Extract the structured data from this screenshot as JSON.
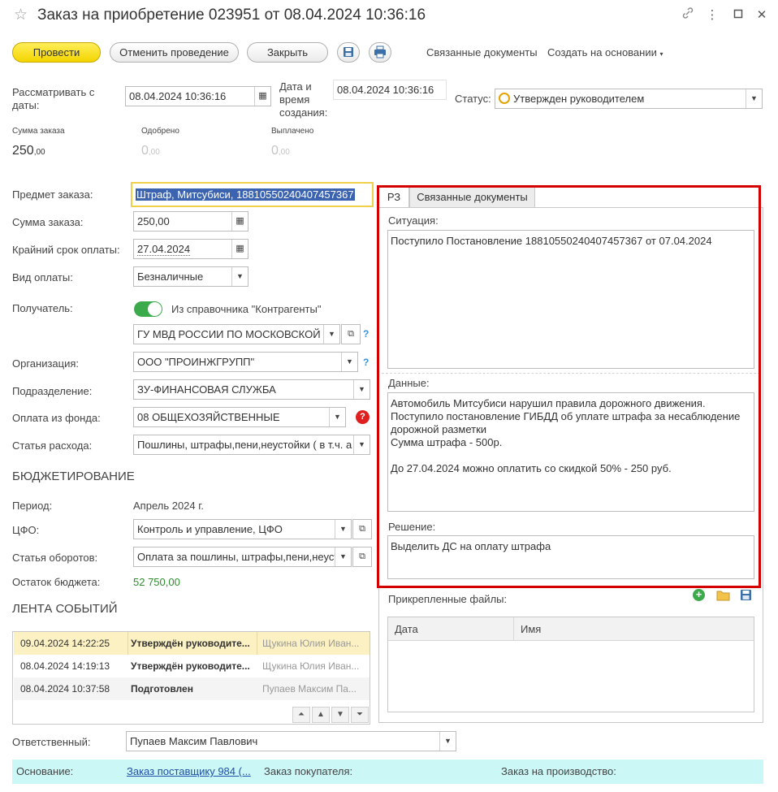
{
  "window": {
    "title": "Заказ на приобретение 023951 от 08.04.2024 10:36:16"
  },
  "toolbar": {
    "post": "Провести",
    "unpost": "Отменить проведение",
    "close": "Закрыть",
    "related_docs": "Связанные документы",
    "create_based": "Создать на основании"
  },
  "header": {
    "consider_from_label": "Рассматривать с даты:",
    "consider_from_value": "08.04.2024 10:36:16",
    "created_label": "Дата и время создания:",
    "created_value": "08.04.2024 10:36:16",
    "status_label": "Статус:",
    "status_value": "Утвержден руководителем"
  },
  "sums": {
    "order_label": "Сумма заказа",
    "order_int": "250",
    "order_dec": ",00",
    "approved_label": "Одобрено",
    "approved_int": "0",
    "approved_dec": ",00",
    "paid_label": "Выплачено",
    "paid_int": "0",
    "paid_dec": ",00"
  },
  "form": {
    "subject_label": "Предмет заказа:",
    "subject_value": "Штраф, Митсубиси, 18810550240407457367",
    "amount_label": "Сумма заказа:",
    "amount_value": "250,00",
    "due_label": "Крайний срок оплаты:",
    "due_value": "27.04.2024",
    "paytype_label": "Вид оплаты:",
    "paytype_value": "Безналичные",
    "recipient_label": "Получатель:",
    "recipient_toggle": "Из справочника \"Контрагенты\"",
    "recipient_value": "ГУ МВД РОССИИ ПО МОСКОВСКОЙ",
    "org_label": "Организация:",
    "org_value": "ООО \"ПРОИНЖГРУПП\"",
    "dept_label": "Подразделение:",
    "dept_value": "ЗУ-ФИНАНСОВАЯ СЛУЖБА",
    "fund_label": "Оплата из фонда:",
    "fund_value": "08 ОБЩЕХОЗЯЙСТВЕННЫЕ",
    "expense_label": "Статья расхода:",
    "expense_value": "Пошлины, штрафы,пени,неустойки ( в т.ч. а"
  },
  "budget": {
    "title": "БЮДЖЕТИРОВАНИЕ",
    "period_label": "Период:",
    "period_value": "Апрель 2024 г.",
    "cfo_label": "ЦФО:",
    "cfo_value": "Контроль и управление, ЦФО",
    "turnover_label": "Статья оборотов:",
    "turnover_value": "Оплата за пошлины, штрафы,пени,неуст",
    "rest_label": "Остаток бюджета:",
    "rest_value": "52 750,00"
  },
  "events": {
    "title": "ЛЕНТА СОБЫТИЙ",
    "rows": [
      {
        "date": "09.04.2024 14:22:25",
        "status": "Утверждён руководите...",
        "user": "Щукина Юлия Иван..."
      },
      {
        "date": "08.04.2024 14:19:13",
        "status": "Утверждён руководите...",
        "user": "Щукина Юлия Иван..."
      },
      {
        "date": "08.04.2024 10:37:58",
        "status": "Подготовлен",
        "user": "Пупаев Максим Па..."
      }
    ]
  },
  "tabs": {
    "rz": "РЗ",
    "related": "Связанные документы"
  },
  "rz": {
    "situation_label": "Ситуация:",
    "situation_text": "Поступило Постановление 18810550240407457367 от 07.04.2024",
    "data_label": "Данные:",
    "data_text": "Автомобиль Митсубиси нарушил правила дорожного движения.\nПоступило постановление ГИБДД об уплате штрафа за несаблюдение дорожной разметки\nСумма штрафа - 500р.\n\nДо 27.04.2024 можно оплатить со скидкой 50% - 250 руб.",
    "decision_label": "Решение:",
    "decision_text": "Выделить ДС на оплату штрафа"
  },
  "files": {
    "label": "Прикрепленные файлы:",
    "col_date": "Дата",
    "col_name": "Имя"
  },
  "footer": {
    "responsible_label": "Ответственный:",
    "responsible_value": "Пупаев Максим Павлович",
    "basis_label": "Основание:",
    "basis_link": "Заказ поставщику 984 (...",
    "customer_order_label": "Заказ покупателя:",
    "production_order_label": "Заказ на производство:"
  },
  "colors": {
    "accent_yellow": "#f7dc1a",
    "highlight_border": "#d40000",
    "info_bar": "#ccf7f7",
    "budget_green": "#2e8b2e",
    "toggle_green": "#3aaa4a"
  }
}
